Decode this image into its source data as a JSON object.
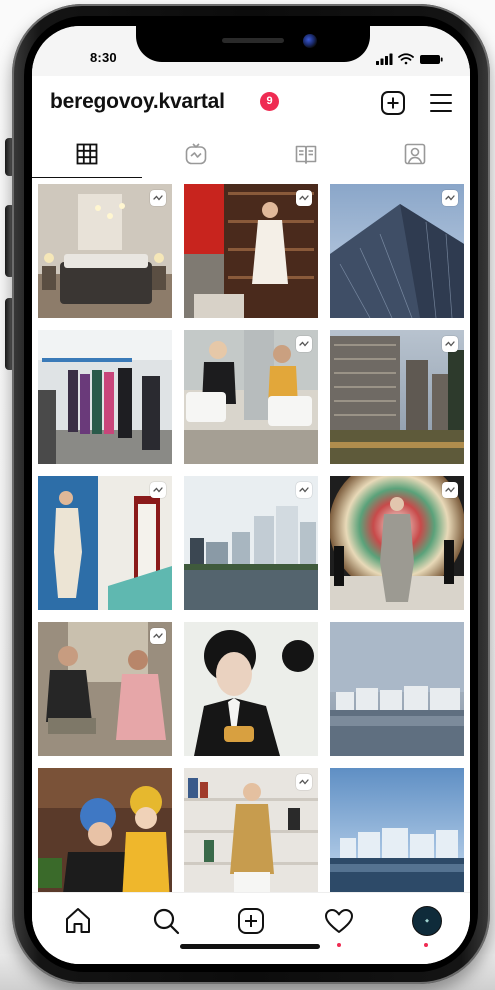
{
  "status_bar": {
    "time": "8:30"
  },
  "profile": {
    "username": "beregovoy.kvartal",
    "notification_count": "9"
  },
  "header_icons": [
    "new-post-icon",
    "menu-icon"
  ],
  "tabs": [
    {
      "name": "grid",
      "icon": "grid-icon",
      "active": true
    },
    {
      "name": "igtv",
      "icon": "igtv-icon",
      "active": false
    },
    {
      "name": "guides",
      "icon": "guides-icon",
      "active": false
    },
    {
      "name": "tagged",
      "icon": "tagged-icon",
      "active": false
    }
  ],
  "posts": [
    {
      "subject": "bedroom-interior",
      "reel": true
    },
    {
      "subject": "woman-in-library",
      "reel": true
    },
    {
      "subject": "glass-skyscraper",
      "reel": true
    },
    {
      "subject": "clothing-store",
      "reel": false
    },
    {
      "subject": "interview-two-women",
      "reel": true
    },
    {
      "subject": "residential-towers-dusk",
      "reel": true
    },
    {
      "subject": "woman-in-blue-room",
      "reel": true
    },
    {
      "subject": "riverside-complex-render",
      "reel": true
    },
    {
      "subject": "fashion-show-pattern",
      "reel": true
    },
    {
      "subject": "conversation-man-woman",
      "reel": true
    },
    {
      "subject": "young-man-portrait",
      "reel": false
    },
    {
      "subject": "waterfront-skyline",
      "reel": false
    },
    {
      "subject": "children-cooking",
      "reel": false
    },
    {
      "subject": "woman-in-bookcase",
      "reel": true
    },
    {
      "subject": "glass-buildings-river",
      "reel": false
    }
  ],
  "bottom_nav": [
    {
      "name": "home",
      "icon": "home-icon",
      "dot": false
    },
    {
      "name": "search",
      "icon": "search-icon",
      "dot": false
    },
    {
      "name": "create",
      "icon": "create-icon",
      "dot": false
    },
    {
      "name": "activity",
      "icon": "heart-icon",
      "dot": true
    },
    {
      "name": "profile",
      "icon": "avatar",
      "dot": true
    }
  ],
  "colors": {
    "badge": "#ef2b52",
    "text": "#111111",
    "background": "#ffffff"
  }
}
